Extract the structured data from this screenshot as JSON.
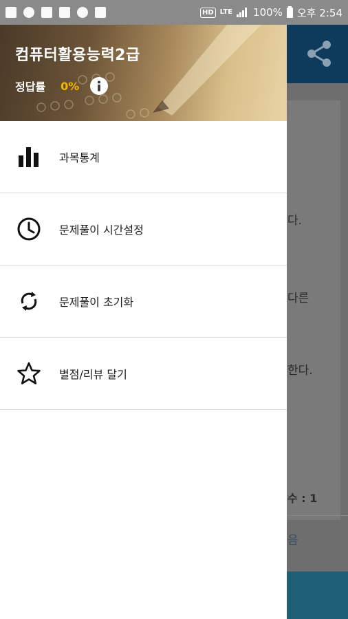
{
  "status_bar": {
    "hd": "HD",
    "lte": "LTE",
    "battery": "100%",
    "time": "오후 2:54"
  },
  "drawer": {
    "title": "컴퓨터활용능력2급",
    "rate_label": "정답률",
    "rate_value": "0%",
    "items": [
      {
        "label": "과목통계",
        "icon": "bar-chart-icon"
      },
      {
        "label": "문제풀이 시간설정",
        "icon": "clock-icon"
      },
      {
        "label": "문제풀이 초기화",
        "icon": "refresh-icon"
      },
      {
        "label": "별점/리뷰 달기",
        "icon": "star-icon"
      }
    ]
  },
  "background_app": {
    "fragments": [
      "다.",
      "다른",
      "한다.",
      "수 : 1",
      "음"
    ]
  },
  "colors": {
    "accent": "#f5b800",
    "toolbar": "#0e3a5c"
  }
}
